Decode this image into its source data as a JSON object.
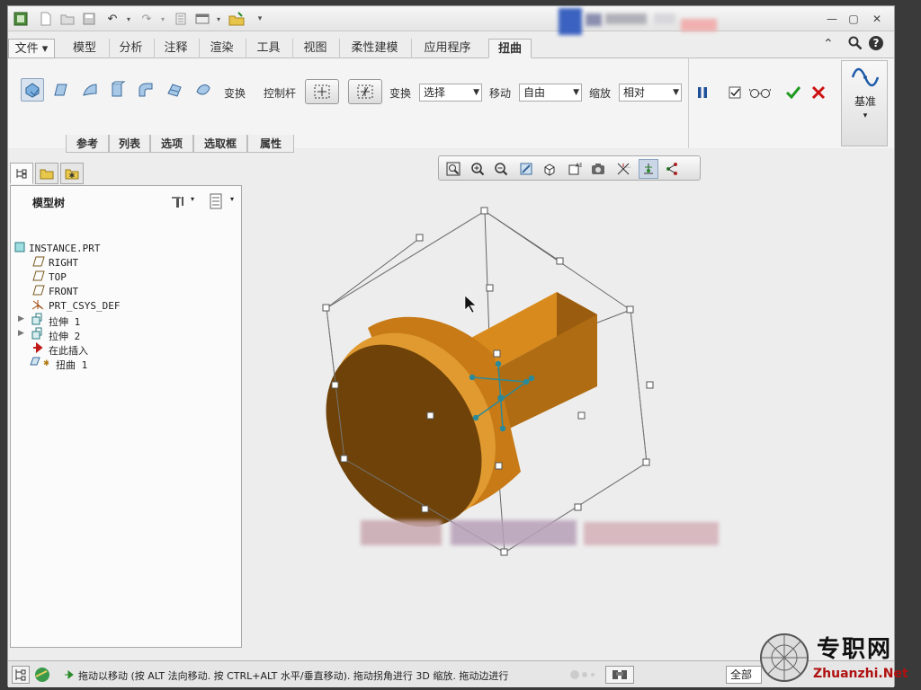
{
  "tabs": [
    "文件",
    "模型",
    "分析",
    "注释",
    "渲染",
    "工具",
    "视图",
    "柔性建模",
    "应用程序",
    "扭曲"
  ],
  "ribbon": {
    "transform_label": "变换",
    "control_rod_label": "控制杆",
    "transform2_label": "变换",
    "transform_select": "选择",
    "move_label": "移动",
    "move_select": "自由",
    "scale_label": "缩放",
    "scale_select": "相对",
    "datum_label": "基准"
  },
  "subtabs": [
    "参考",
    "列表",
    "选项",
    "选取框",
    "属性"
  ],
  "model_tree": {
    "title": "模型树",
    "items": [
      {
        "label": "INSTANCE.PRT",
        "icon": "part-icon"
      },
      {
        "label": "RIGHT",
        "icon": "datum-plane-icon"
      },
      {
        "label": "TOP",
        "icon": "datum-plane-icon"
      },
      {
        "label": "FRONT",
        "icon": "datum-plane-icon"
      },
      {
        "label": "PRT_CSYS_DEF",
        "icon": "csys-icon"
      },
      {
        "label": "拉伸 1",
        "icon": "extrude-icon"
      },
      {
        "label": "拉伸 2",
        "icon": "extrude-icon"
      },
      {
        "label": "在此插入",
        "icon": "insert-arrow-icon"
      },
      {
        "label": "扭曲 1",
        "icon": "warp-icon"
      }
    ]
  },
  "status": {
    "message": "拖动以移动 (按 ALT 法向移动. 按 CTRL+ALT 水平/垂直移动). 拖动拐角进行 3D 缩放. 拖动边进行",
    "filter": "全部"
  },
  "watermark": {
    "text": "专职网",
    "url_text": "Zhuanzhi.Net"
  },
  "colors": {
    "model": "#c77a16",
    "model_dark": "#6e4208",
    "accept": "#1f9a1f",
    "cancel": "#cc1111",
    "ui_bg": "#ededed"
  }
}
